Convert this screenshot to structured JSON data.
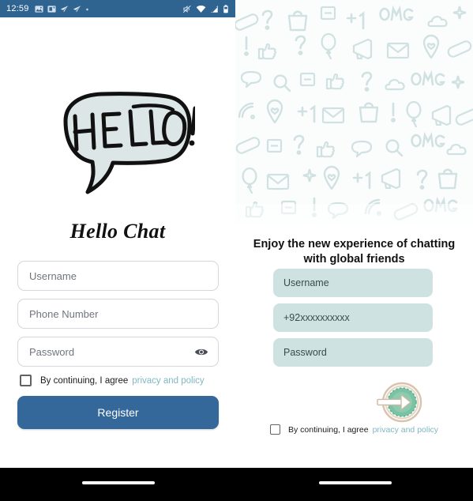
{
  "status_bar": {
    "time": "12:59",
    "left_icons": [
      "image-icon",
      "screenshot-icon",
      "telegram-icon",
      "telegram-icon",
      "dot-icon"
    ],
    "right_icons": [
      "mute-icon",
      "wifi-icon",
      "signal-icon",
      "battery-icon"
    ],
    "background": "#2f6390"
  },
  "left_panel": {
    "logo": {
      "icon_name": "hello-speech-bubble-logo",
      "text": "HELLO!"
    },
    "app_title": "Hello Chat",
    "fields": [
      {
        "name": "username-input",
        "placeholder": "Username",
        "value": ""
      },
      {
        "name": "phone-number-input",
        "placeholder": "Phone Number",
        "value": ""
      },
      {
        "name": "password-input",
        "placeholder": "Password",
        "value": ""
      }
    ],
    "password_toggle_icon": "eye-icon",
    "agreement": {
      "checked": false,
      "text": "By continuing, I agree",
      "link": "privacy and policy"
    },
    "register_button": "Register"
  },
  "right_panel": {
    "doodle_pattern": {
      "icon_name": "doodle-pattern",
      "doodles": [
        "question-mark",
        "exclamation-mark",
        "thumbs-up",
        "envelope",
        "magnifier",
        "handbag",
        "OMG",
        "plus-one",
        "speech-bubble",
        "megaphone",
        "heart-pin",
        "cloud",
        "wifi-arc",
        "balloon"
      ]
    },
    "tagline": "Enjoy the new experience of chatting with global friends",
    "fields": [
      {
        "name": "username-input",
        "placeholder": "Username",
        "value": ""
      },
      {
        "name": "phone-input",
        "placeholder": "+92xxxxxxxxxx",
        "value": ""
      },
      {
        "name": "password-input",
        "placeholder": "Password",
        "value": ""
      }
    ],
    "submit_button": {
      "name": "go-arrow-button",
      "icon": "arrow-right-icon"
    },
    "agreement": {
      "checked": false,
      "text": "By continuing, I agree",
      "link": "privacy and policy"
    }
  },
  "colors": {
    "status_bar": "#2f6390",
    "register_button": "#34689a",
    "filled_field": "#cfe2e2",
    "link": "#7fb8c4",
    "go_button_fill": "#79c2a4",
    "go_button_ring": "#d9c3ae",
    "nav_bar": "#000000"
  }
}
